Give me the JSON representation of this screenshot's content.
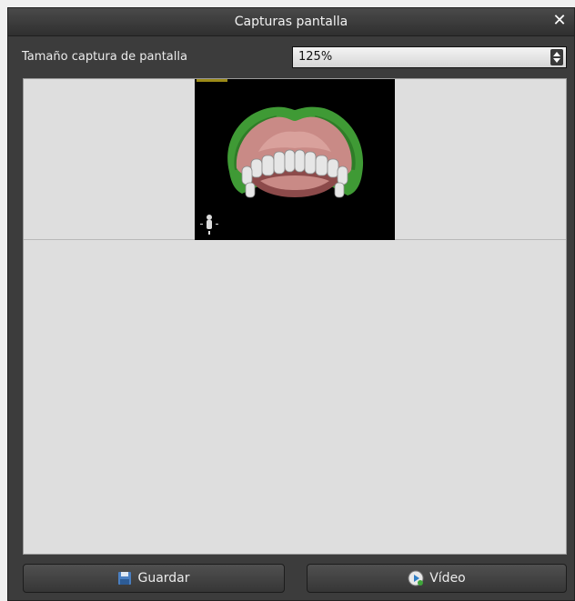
{
  "window": {
    "title": "Capturas pantalla",
    "close_symbol": "✕"
  },
  "settings": {
    "size_label": "Tamaño captura de pantalla",
    "size_value": "125%"
  },
  "buttons": {
    "save_label": "Guardar",
    "save_icon": "floppy-disk-icon",
    "video_label": "Vídeo",
    "video_icon": "video-play-icon"
  }
}
